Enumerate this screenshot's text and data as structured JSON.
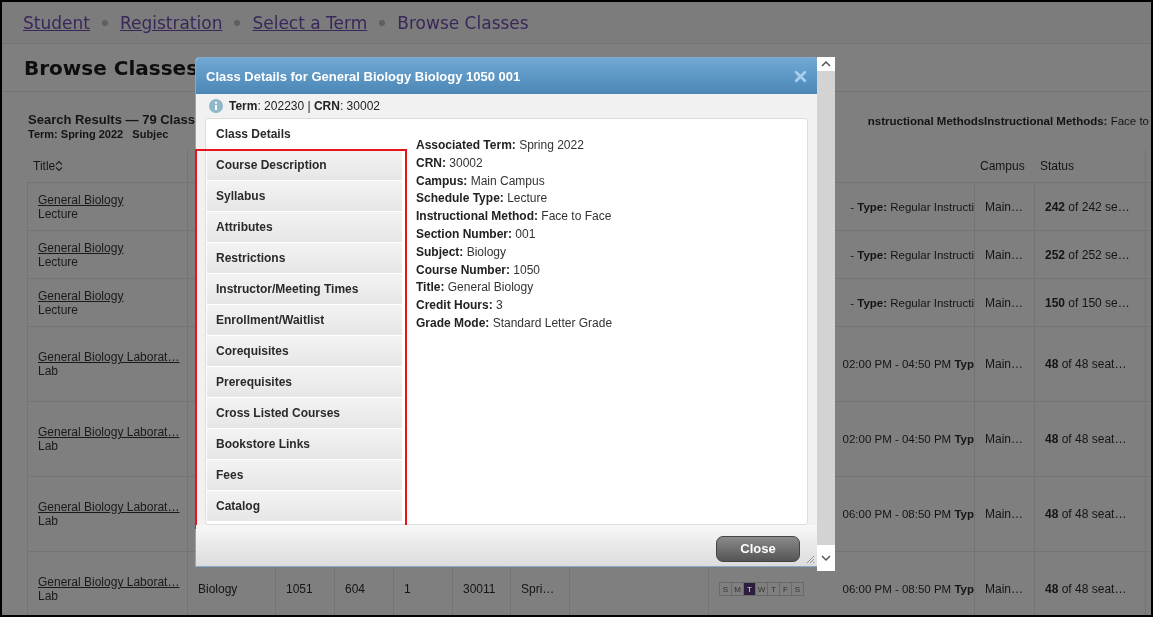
{
  "breadcrumbs": [
    {
      "label": "Student",
      "current": false
    },
    {
      "label": "Registration",
      "current": false
    },
    {
      "label": "Select a Term",
      "current": false
    },
    {
      "label": "Browse Classes",
      "current": true
    }
  ],
  "page_title": "Browse Classes",
  "search_results": {
    "title": "Search Results — 79 Class",
    "filters": "Term: Spring 2022   Subjec",
    "methods": "**nstructional MethodsInstructional Methods:** Face to"
  },
  "table": {
    "columns": [
      {
        "kind": "title",
        "label": "Title",
        "sortable": true
      },
      {
        "kind": "campus",
        "label": "Campus"
      },
      {
        "kind": "status",
        "label": "Status"
      }
    ],
    "rows": [
      {
        "kind": "lecture",
        "title": "General Biology",
        "schedule_type": "Lecture",
        "meeting": "- **Type:** Regular Instructi",
        "campus": "Main…",
        "status": "**242** of 242 se…"
      },
      {
        "kind": "lecture",
        "title": "General Biology",
        "schedule_type": "Lecture",
        "meeting": "- **Type:** Regular Instructi",
        "campus": "Main…",
        "status": "**252** of 252 se…"
      },
      {
        "kind": "lecture",
        "title": "General Biology",
        "schedule_type": "Lecture",
        "meeting": "- **Type:** Regular Instructi",
        "campus": "Main…",
        "status": "**150** of 150 se…"
      },
      {
        "kind": "lab",
        "title": "General Biology Laborat…",
        "schedule_type": "Lab",
        "meeting": "02:00 PM - 04:50 PM **Typ**",
        "campus": "Main…",
        "status": "**48** of 48 seat…"
      },
      {
        "kind": "lab",
        "title": "General Biology Laborat…",
        "schedule_type": "Lab",
        "meeting": "02:00 PM - 04:50 PM **Typ**",
        "campus": "Main…",
        "status": "**48** of 48 seat…"
      },
      {
        "kind": "lab",
        "title": "General Biology Laborat…",
        "schedule_type": "Lab",
        "meeting": "06:00 PM - 08:50 PM **Typ**",
        "campus": "Main…",
        "status": "**48** of 48 seat…"
      },
      {
        "kind": "lab",
        "title": "General Biology Laborat…",
        "schedule_type": "Lab",
        "cells": [
          "Biology",
          "1051",
          "604",
          "1",
          "30011",
          "Spri…"
        ],
        "days": [
          {
            "label": "S",
            "selected": false
          },
          {
            "label": "M",
            "selected": false
          },
          {
            "label": "T",
            "selected": true
          },
          {
            "label": "W",
            "selected": false
          },
          {
            "label": "T",
            "selected": false
          },
          {
            "label": "F",
            "selected": false
          },
          {
            "label": "S",
            "selected": false
          }
        ],
        "meeting": "06:00 PM - 08:50 PM **Typ**",
        "campus": "Main…",
        "status": "**48** of 48 seat…"
      }
    ]
  },
  "dialog": {
    "title": "Class Details for General Biology Biology 1050 001",
    "info": "**Term**: 202230 | **CRN**: 30002",
    "highlighted": true,
    "tabs": [
      {
        "label": "Class Details",
        "selected": true
      },
      {
        "label": "Course Description",
        "selected": false
      },
      {
        "label": "Syllabus",
        "selected": false
      },
      {
        "label": "Attributes",
        "selected": false
      },
      {
        "label": "Restrictions",
        "selected": false
      },
      {
        "label": "Instructor/Meeting Times",
        "selected": false
      },
      {
        "label": "Enrollment/Waitlist",
        "selected": false
      },
      {
        "label": "Corequisites",
        "selected": false
      },
      {
        "label": "Prerequisites",
        "selected": false
      },
      {
        "label": "Cross Listed Courses",
        "selected": false
      },
      {
        "label": "Bookstore Links",
        "selected": false
      },
      {
        "label": "Fees",
        "selected": false
      },
      {
        "label": "Catalog",
        "selected": false
      }
    ],
    "details": [
      {
        "label": "Associated Term:",
        "value": "Spring 2022"
      },
      {
        "label": "CRN:",
        "value": "30002"
      },
      {
        "label": "Campus:",
        "value": "Main Campus"
      },
      {
        "label": "Schedule Type:",
        "value": "Lecture"
      },
      {
        "label": "Instructional Method:",
        "value": "Face to Face"
      },
      {
        "label": "Section Number:",
        "value": "001"
      },
      {
        "label": "Subject:",
        "value": "Biology"
      },
      {
        "label": "Course Number:",
        "value": "1050"
      },
      {
        "label": "Title:",
        "value": "General Biology"
      },
      {
        "label": "Credit Hours:",
        "value": "3"
      },
      {
        "label": "Grade Mode:",
        "value": "Standard Letter Grade"
      }
    ],
    "close_label": "Close"
  }
}
